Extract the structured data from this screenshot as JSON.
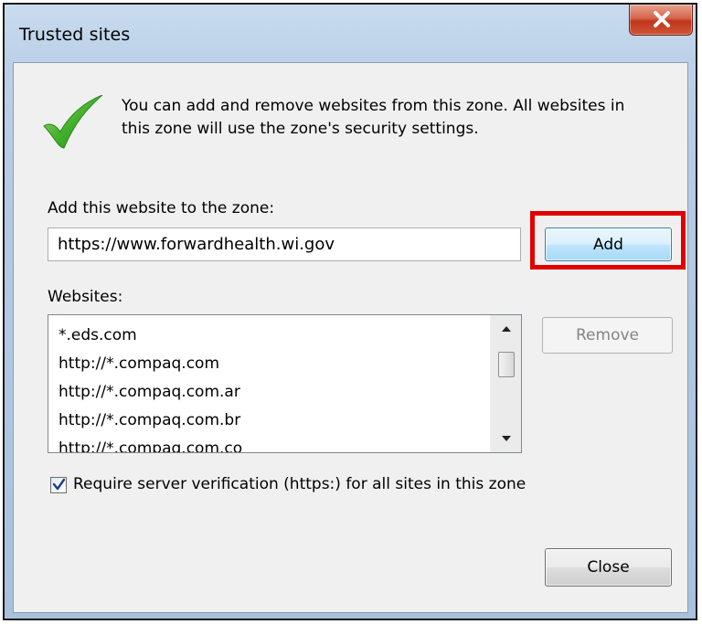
{
  "window": {
    "title": "Trusted sites",
    "close_glyph": "X"
  },
  "icons": {
    "title_close": "close-icon",
    "zone": "green-checkmark-icon",
    "scroll_up": "scroll-up-arrow-icon",
    "scroll_down": "scroll-down-arrow-icon",
    "checkbox_mark": "checkmark-icon"
  },
  "description": {
    "line1": "You can add and remove websites from this zone. All websites in",
    "line2": "this zone will use the zone's security settings."
  },
  "add_section": {
    "label": "Add this website to the zone:",
    "input_value": "https://www.forwardhealth.wi.gov",
    "add_button": "Add"
  },
  "websites": {
    "label": "Websites:",
    "items": [
      "*.eds.com",
      "http://*.compaq.com",
      "http://*.compaq.com.ar",
      "http://*.compaq.com.br",
      "http://*.compaq.com.co"
    ],
    "remove_button": "Remove"
  },
  "require_https": {
    "label": "Require server verification (https:) for all sites in this zone",
    "checked": true
  },
  "footer": {
    "close_button": "Close"
  },
  "colors": {
    "highlight": "#e00000",
    "check_green": "#3fae2a",
    "dialog_bg": "#f0f0f0"
  }
}
